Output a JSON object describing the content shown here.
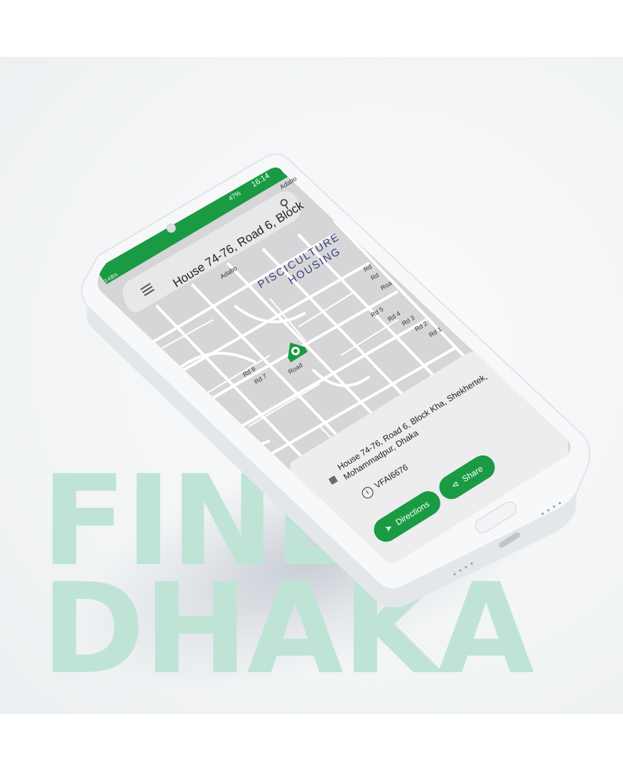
{
  "hero": {
    "line1": "FIND",
    "line2": "DHAKA"
  },
  "status_bar": {
    "time": "16:14",
    "battery": "47%",
    "speed": "3 KB/s"
  },
  "search_bar": {
    "text": "House 74-76, Road 6, Block",
    "menu_icon": "hamburger-menu-icon",
    "search_icon": "search-icon"
  },
  "map": {
    "area_label_line1": "PISCICULTURE",
    "area_label_line2": "HOUSING",
    "roads": [
      "Rd 8",
      "Rd 7",
      "Road",
      "Rd 5",
      "Rd 4",
      "Rd 3",
      "Rd 2",
      "Rd 1",
      "Rd",
      "Rd",
      "Roa",
      "Adabo",
      "Adabo"
    ],
    "pin_icon": "location-pin-icon"
  },
  "place_card": {
    "address_line1": "House 74-76, Road 6, Block Kha, Shekhertek,",
    "address_line2": "Mohammadpur, Dhaka",
    "id": "VFAI6676",
    "directions_label": "Directions",
    "share_label": "Share"
  },
  "colors": {
    "accent": "#1a9a43",
    "hero_text": "#bfe4d6",
    "map_bg": "#d6d6d8",
    "map_roads": "#ffffff"
  }
}
